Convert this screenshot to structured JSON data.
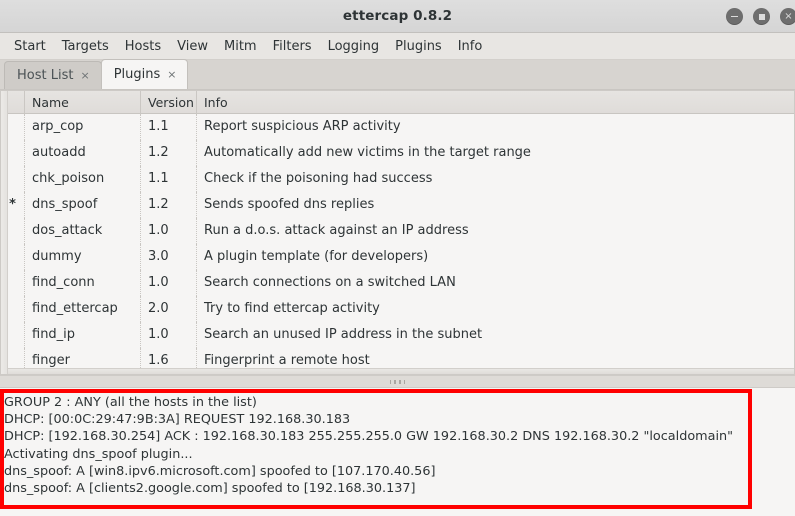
{
  "window": {
    "title": "ettercap 0.8.2",
    "controls": [
      {
        "name": "minimize",
        "glyph": "–"
      },
      {
        "name": "maximize",
        "glyph": "□"
      },
      {
        "name": "close",
        "glyph": "×"
      }
    ]
  },
  "menubar": {
    "items": [
      {
        "id": "start",
        "label": "Start"
      },
      {
        "id": "targets",
        "label": "Targets"
      },
      {
        "id": "hosts",
        "label": "Hosts"
      },
      {
        "id": "view",
        "label": "View"
      },
      {
        "id": "mitm",
        "label": "Mitm"
      },
      {
        "id": "filters",
        "label": "Filters"
      },
      {
        "id": "logging",
        "label": "Logging"
      },
      {
        "id": "plugins",
        "label": "Plugins"
      },
      {
        "id": "info",
        "label": "Info"
      }
    ]
  },
  "tabs": [
    {
      "id": "host-list",
      "label": "Host List",
      "active": false,
      "close_glyph": "×"
    },
    {
      "id": "plugins",
      "label": "Plugins",
      "active": true,
      "close_glyph": "×"
    }
  ],
  "plugin_table": {
    "columns": [
      {
        "id": "mark",
        "label": ""
      },
      {
        "id": "name",
        "label": "Name"
      },
      {
        "id": "version",
        "label": "Version"
      },
      {
        "id": "info",
        "label": "Info"
      }
    ],
    "rows": [
      {
        "mark": "",
        "name": "arp_cop",
        "version": "1.1",
        "info": "Report suspicious ARP activity"
      },
      {
        "mark": "",
        "name": "autoadd",
        "version": "1.2",
        "info": "Automatically add new victims in the target range"
      },
      {
        "mark": "",
        "name": "chk_poison",
        "version": "1.1",
        "info": "Check if the poisoning had success"
      },
      {
        "mark": "*",
        "name": "dns_spoof",
        "version": "1.2",
        "info": "Sends spoofed dns replies"
      },
      {
        "mark": "",
        "name": "dos_attack",
        "version": "1.0",
        "info": "Run a d.o.s. attack against an IP address"
      },
      {
        "mark": "",
        "name": "dummy",
        "version": "3.0",
        "info": "A plugin template (for developers)"
      },
      {
        "mark": "",
        "name": "find_conn",
        "version": "1.0",
        "info": "Search connections on a switched LAN"
      },
      {
        "mark": "",
        "name": "find_ettercap",
        "version": "2.0",
        "info": "Try to find ettercap activity"
      },
      {
        "mark": "",
        "name": "find_ip",
        "version": "1.0",
        "info": "Search an unused IP address in the subnet"
      },
      {
        "mark": "",
        "name": "finger",
        "version": "1.6",
        "info": "Fingerprint a remote host"
      }
    ]
  },
  "log_panel": {
    "highlight_color": "#ff0000",
    "lines": [
      "GROUP 2 : ANY (all the hosts in the list)",
      "DHCP: [00:0C:29:47:9B:3A] REQUEST 192.168.30.183",
      "DHCP: [192.168.30.254] ACK : 192.168.30.183 255.255.255.0 GW 192.168.30.2 DNS 192.168.30.2 \"localdomain\"",
      "Activating dns_spoof plugin...",
      "dns_spoof: A [win8.ipv6.microsoft.com] spoofed to [107.170.40.56]",
      "dns_spoof: A [clients2.google.com] spoofed to [192.168.30.137]"
    ]
  }
}
